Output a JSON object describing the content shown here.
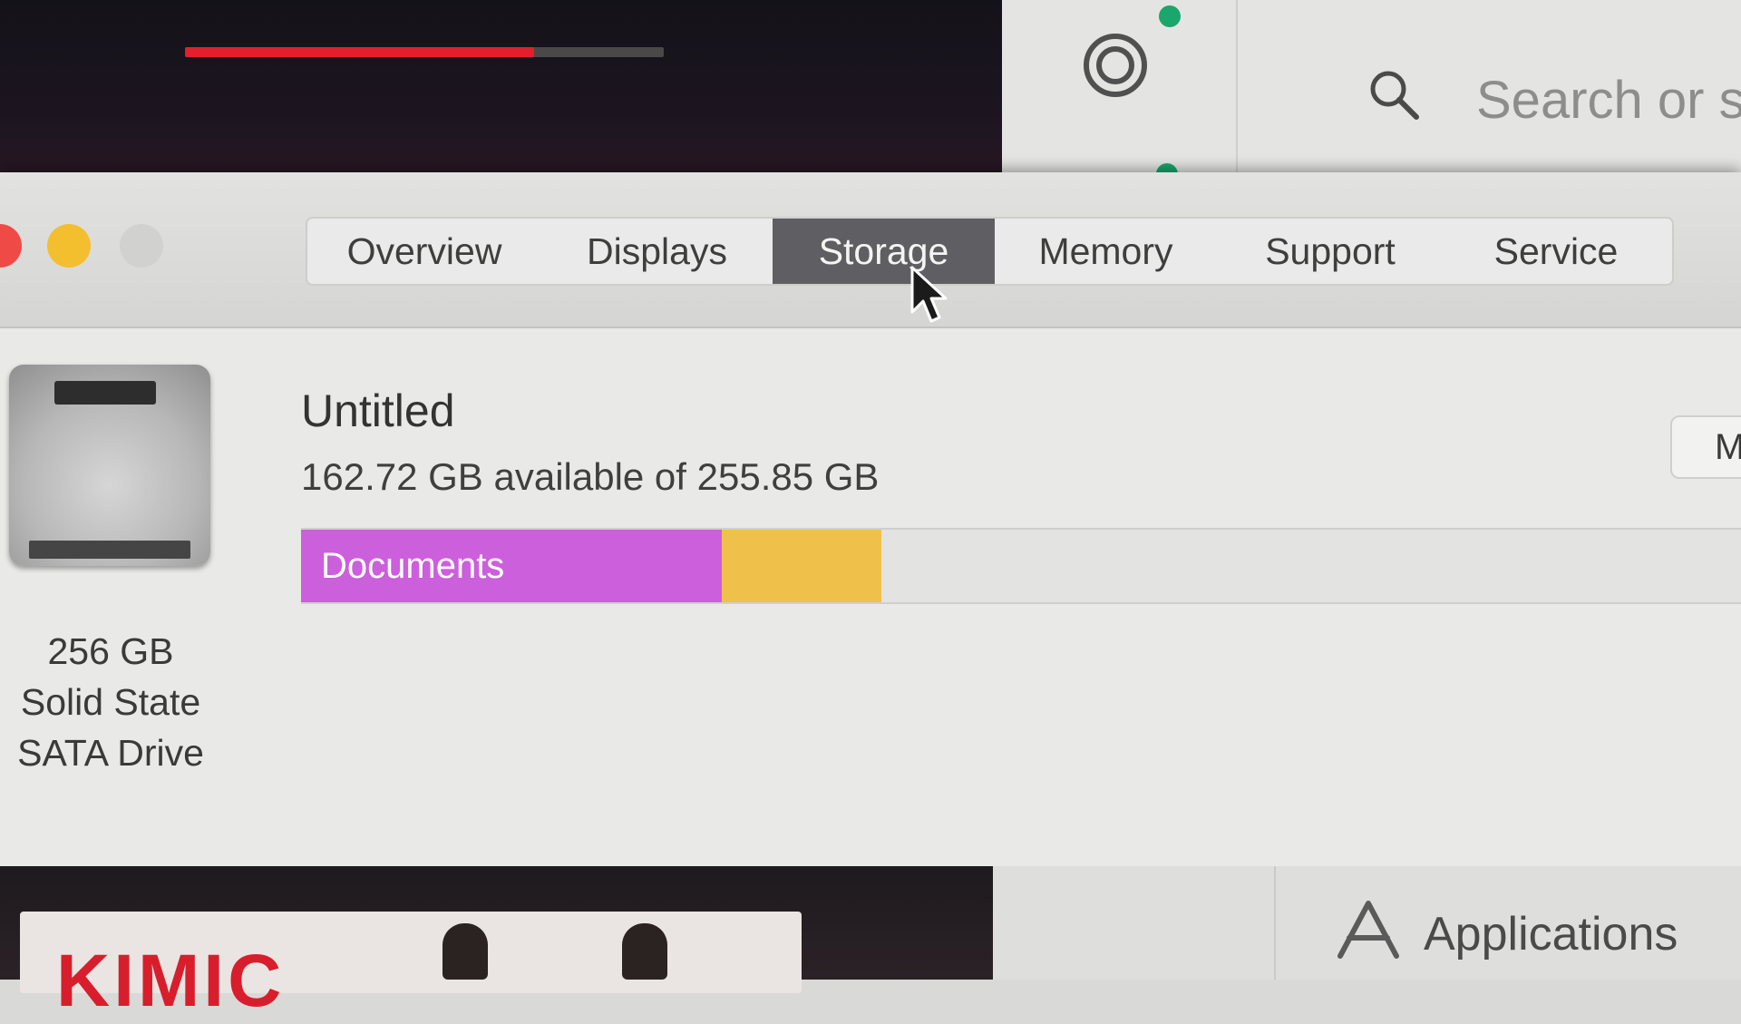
{
  "background": {
    "video_progress_percent": 73,
    "search_placeholder": "Search or s",
    "applications_label": "Applications",
    "thumbnail_text": "KIMIC"
  },
  "window": {
    "tabs": [
      {
        "label": "Overview",
        "active": false
      },
      {
        "label": "Displays",
        "active": false
      },
      {
        "label": "Storage",
        "active": true
      },
      {
        "label": "Memory",
        "active": false
      },
      {
        "label": "Support",
        "active": false
      },
      {
        "label": "Service",
        "active": false
      }
    ],
    "drive": {
      "capacity": "256 GB",
      "type_line1": "Solid State",
      "type_line2": "SATA Drive"
    },
    "volume": {
      "name": "Untitled",
      "availability": "162.72 GB available of 255.85 GB",
      "manage_button_partial": "M",
      "segments": [
        {
          "label": "Documents",
          "color": "#cc5fdb",
          "fraction": 0.29
        },
        {
          "label": "",
          "color": "#efc14a",
          "fraction": 0.11
        }
      ]
    }
  },
  "colors": {
    "active_tab": "#5f5e62",
    "progress_red": "#e41f2c",
    "close": "#ef4a45",
    "minimize": "#f3bf2f",
    "extension_dot": "#1aa66c"
  }
}
